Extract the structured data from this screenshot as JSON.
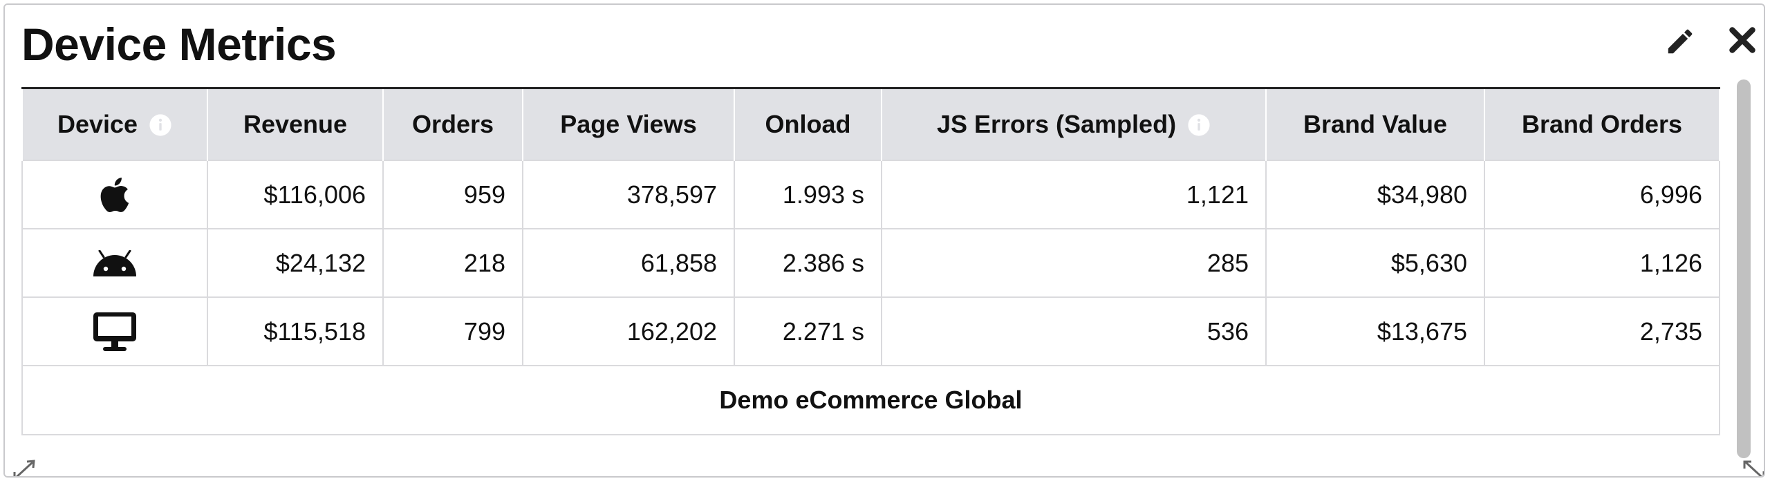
{
  "widget": {
    "title": "Device Metrics",
    "tools": {
      "edit_icon": "pencil-icon",
      "close_icon": "close-icon"
    }
  },
  "table": {
    "headers": [
      {
        "label": "Device",
        "info_icon": true
      },
      {
        "label": "Revenue"
      },
      {
        "label": "Orders"
      },
      {
        "label": "Page Views"
      },
      {
        "label": "Onload"
      },
      {
        "label": "JS Errors (Sampled)",
        "info_icon": true
      },
      {
        "label": "Brand Value"
      },
      {
        "label": "Brand Orders"
      }
    ],
    "rows": [
      {
        "device_icon": "apple-icon",
        "revenue": "$116,006",
        "orders": "959",
        "page_views": "378,597",
        "onload": "1.993 s",
        "js_errors": "1,121",
        "brand_value": "$34,980",
        "brand_orders": "6,996"
      },
      {
        "device_icon": "android-icon",
        "revenue": "$24,132",
        "orders": "218",
        "page_views": "61,858",
        "onload": "2.386 s",
        "js_errors": "285",
        "brand_value": "$5,630",
        "brand_orders": "1,126"
      },
      {
        "device_icon": "desktop-icon",
        "revenue": "$115,518",
        "orders": "799",
        "page_views": "162,202",
        "onload": "2.271 s",
        "js_errors": "536",
        "brand_value": "$13,675",
        "brand_orders": "2,735"
      }
    ],
    "footer": "Demo eCommerce Global"
  },
  "colors": {
    "header_bg": "#e0e1e5",
    "grid": "#dadadd",
    "text": "#111111",
    "scrollbar": "#c1c1c1"
  }
}
